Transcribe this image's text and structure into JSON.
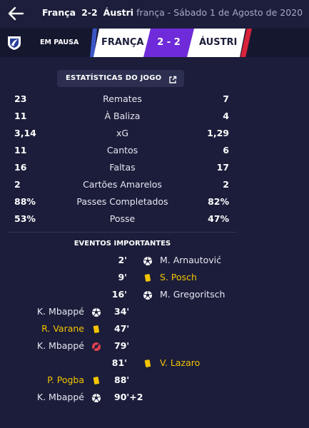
{
  "header": {
    "home_team": "França",
    "score": "2-2",
    "away_team": "Áustri",
    "subtitle": "frança - Sábado 1 de Agosto de 2020"
  },
  "scoreboard": {
    "status": "EM PAUSA",
    "home": "FRANÇA",
    "score": "2 - 2",
    "away": "ÁUSTRI",
    "colors": {
      "home_stripe": "#3c57c6",
      "score_bg": "#6f2bd9",
      "away_stripe": "#d8233a"
    }
  },
  "stats": {
    "title": "ESTATÍSTICAS DO JOGO",
    "rows": [
      {
        "home": "23",
        "label": "Remates",
        "away": "7"
      },
      {
        "home": "11",
        "label": "À Baliza",
        "away": "4"
      },
      {
        "home": "3,14",
        "label": "xG",
        "away": "1,29"
      },
      {
        "home": "11",
        "label": "Cantos",
        "away": "6"
      },
      {
        "home": "16",
        "label": "Faltas",
        "away": "17"
      },
      {
        "home": "2",
        "label": "Cartões Amarelos",
        "away": "2"
      },
      {
        "home": "88%",
        "label": "Passes Completados",
        "away": "82%"
      },
      {
        "home": "53%",
        "label": "Posse",
        "away": "47%"
      }
    ]
  },
  "events": {
    "title": "EVENTOS IMPORTANTES",
    "items": [
      {
        "side": "away",
        "minute": "2'",
        "player": "M. Arnautović",
        "type": "goal-icon",
        "highlight": false
      },
      {
        "side": "away",
        "minute": "9'",
        "player": "S. Posch",
        "type": "yellow-card-icon",
        "highlight": true
      },
      {
        "side": "away",
        "minute": "16'",
        "player": "M. Gregoritsch",
        "type": "goal-icon",
        "highlight": false
      },
      {
        "side": "home",
        "minute": "34'",
        "player": "K. Mbappé",
        "type": "goal-icon",
        "highlight": false
      },
      {
        "side": "home",
        "minute": "47'",
        "player": "R. Varane",
        "type": "yellow-card-icon",
        "highlight": true
      },
      {
        "side": "home",
        "minute": "79'",
        "player": "K. Mbappé",
        "type": "missed-penalty-icon",
        "highlight": false
      },
      {
        "side": "away",
        "minute": "81'",
        "player": "V. Lazaro",
        "type": "yellow-card-icon",
        "highlight": true
      },
      {
        "side": "home",
        "minute": "88'",
        "player": "P. Pogba",
        "type": "yellow-card-icon",
        "highlight": true
      },
      {
        "side": "home",
        "minute": "90'+2",
        "player": "K. Mbappé",
        "type": "goal-icon",
        "highlight": false
      }
    ]
  }
}
